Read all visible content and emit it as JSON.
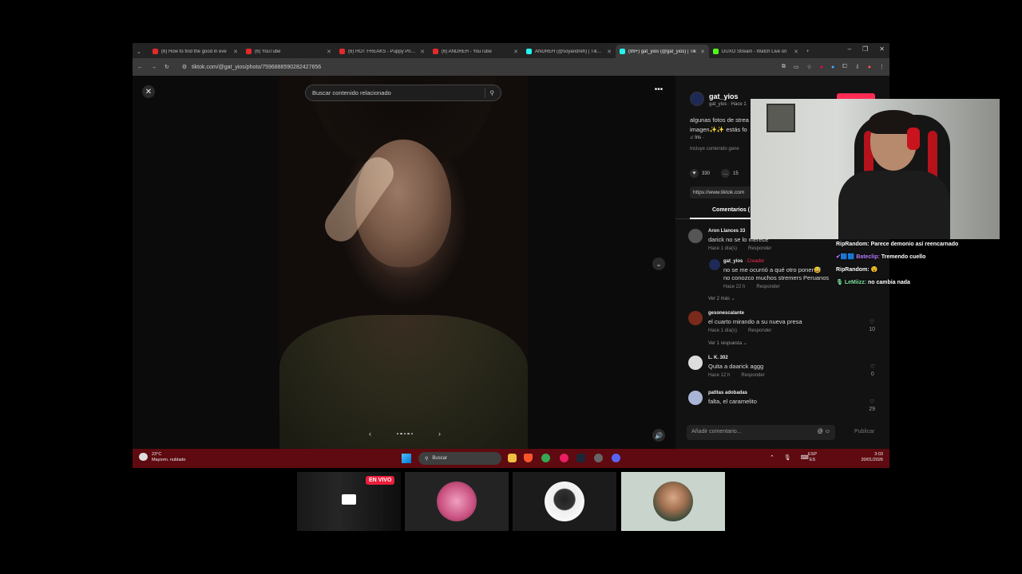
{
  "browser": {
    "tabs": [
      {
        "title": "(6) How to find the good in eve",
        "color": "#e02b2b"
      },
      {
        "title": "(6) YouTube",
        "color": "#e02b2b"
      },
      {
        "title": "(6) HOT FREAKS - Puppy Prince",
        "color": "#e02b2b"
      },
      {
        "title": "(6) ANDREH - YouTube",
        "color": "#e02b2b"
      },
      {
        "title": "ANDREH (@soyandreh) | TikTok",
        "color": "#25f4ee"
      },
      {
        "title": "(99+) gat_yios (@gat_yios) | Tik",
        "color": "#25f4ee"
      },
      {
        "title": "DUXO Stream - Watch Live on",
        "color": "#53fc18"
      }
    ],
    "new_tab": "+",
    "url": "tiktok.com/@gat_yios/photo/7596888590282427656",
    "window_controls": [
      "–",
      "❐",
      "✕"
    ]
  },
  "viewer": {
    "close": "✕",
    "search_placeholder": "Buscar contenido relacionado",
    "more": "•••",
    "prev": "‹",
    "next": "›",
    "down": "⌄",
    "sound": "🔊"
  },
  "panel": {
    "author_name": "gat_yios",
    "author_sub": "gat_yios · Hace 1",
    "caption_l1": "algunas fotos de strea",
    "caption_l2": "imagen✨✨ estás fo",
    "music": "♫  Iris ·",
    "ai_note": "Incluye contenido gene",
    "likes": "330",
    "comments_count": "15",
    "link": "https://www.tiktok.com",
    "comments_tab": "Comentarios (",
    "comments": [
      {
        "name": "Aron Llances 33",
        "text": "darick no se lo merece",
        "time": "Hace 1 día(s)",
        "reply": "Responder",
        "avatar": "#555"
      },
      {
        "name": "gat_yios",
        "tag": "· Creador",
        "text1": "no se me ocurrió a qué otro poner😅",
        "text2": "no conozco muchos stremers Peruanos",
        "time": "Hace 22 h",
        "reply": "Responder"
      },
      {
        "name": "gesonescalante",
        "text": "el cuarto mirando a su nueva presa",
        "time": "Hace 1 día(s)",
        "reply": "Responder",
        "likes": "10",
        "avatar": "#7a2a1a"
      },
      {
        "name": "L. K. 302",
        "text": "Quita a daarick aggg",
        "time": "Hace 12 h",
        "reply": "Responder",
        "likes": "0",
        "avatar": "#ddd"
      },
      {
        "name": "patitas adobadas",
        "text": "falta, el caramelito",
        "likes": "29",
        "avatar": "#a9b4d6"
      }
    ],
    "more_replies_1": "Ver 2 más ⌄",
    "more_replies_2": "Ver 1 respuesta ⌄",
    "input_placeholder": "Añadir comentario...",
    "input_icons": "@ ☺",
    "publish": "Publicar"
  },
  "taskbar": {
    "temp": "23°C",
    "weather": "Mayorm. nublado",
    "search": "Buscar",
    "time": "3:03",
    "date": "20/01/2026",
    "lang1": "ESP",
    "lang2": "ES",
    "tray": "⌃ 🎙 ⌨"
  },
  "chat": [
    {
      "user": "RipRandom:",
      "msg": "Parece demonio así reencarnado"
    },
    {
      "user": "✔🟦🟦 Bateclip:",
      "msg": "Tremendo cuello"
    },
    {
      "user": "RipRandom:",
      "msg": "😵"
    },
    {
      "user": "🎙 LeMiizz:",
      "msg": "no cambia nada"
    }
  ],
  "participants": {
    "live_badge": "EN VIVO"
  }
}
